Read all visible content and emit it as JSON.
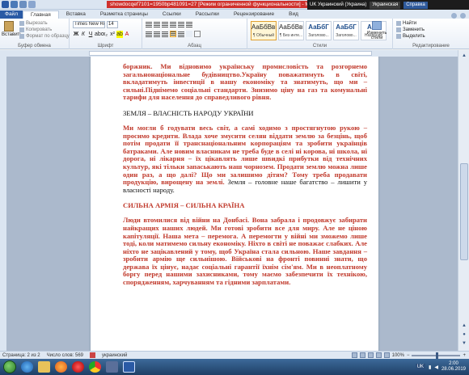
{
  "titlebar": {
    "doc_title": "showdocqef7101=1950bp481091=27 [Режим ограниченной функциональности] - Microsoft Word",
    "lang_label": "UK Украинский (Украина)",
    "kb_layout": "Украинская",
    "help_label": "Справка"
  },
  "tabs": [
    "Файл",
    "Главная",
    "Вставка",
    "Разметка страницы",
    "Ссылки",
    "Рассылки",
    "Рецензирование",
    "Вид"
  ],
  "ribbon": {
    "paste_label": "Вставить",
    "cut_label": "Вырезать",
    "copy_label": "Копировать",
    "format_painter_label": "Формат по образцу",
    "clipboard_group": "Буфер обмена",
    "font_name": "Times New Rom",
    "font_size": "14",
    "font_group": "Шрифт",
    "para_group": "Абзац",
    "styles": [
      {
        "sample": "АаБбВвГ",
        "name": "¶ Обычный",
        "heading": false
      },
      {
        "sample": "АаБбВвГ",
        "name": "¶ Без инте...",
        "heading": false
      },
      {
        "sample": "АаБбГ",
        "name": "Заголово...",
        "heading": true
      },
      {
        "sample": "АаБбГ",
        "name": "Заголово...",
        "heading": true
      },
      {
        "sample": "АаБ",
        "name": "Название",
        "heading": true
      }
    ],
    "styles_group": "Стили",
    "change_styles_label": "Изменить стили",
    "find_label": "Найти",
    "replace_label": "Заменить",
    "select_label": "Выделить",
    "edit_group": "Редактирование"
  },
  "document": {
    "p1": "боржник. Ми відновимо українську промисловість та розгорнемо загальнонаціональне будівництво.Україну поважатимуть в світі, вкладатимуть інвестиції в нашу економіку та знатимуть, що ми – сильні.Піднімемо соціальні стандарти. Знизимо ціну на газ та комунальні тарифи для населення до справедливого рівня.",
    "h1": "ЗЕМЛЯ – ВЛАСНІСТЬ НАРОДУ УКРАЇНИ",
    "p2_red": "Ми могли б годувати весь світ, а самі ходимо з простягнутою рукою – просимо кредити. Влада хоче змусити селян віддати землю за безцінь, щоб потім продати її транснаціональним корпораціям та зробити українців батраками. Але новим власникам не треба буде в селі ні корова, ні школа, ні дорога, ні лікарня – їх цікавлять лише швидкі прибутки від технічних культур, які тільки запаськають наш чорнозем. Продати землю можна лише один раз, а що далі? Що ми залишимо дітям? Тому треба продавати продукцію, вирощену на землі.",
    "p2_black": " Земля – головне наше багатство – лишити у власності народу.",
    "h2": "СИЛЬНА АРМІЯ – СИЛЬНА КРАЇНА",
    "p3": "Люди втомилися від війни на Донбасі. Вона забрала і продовжує забирати найкращих наших людей. Ми готові зробити все для миру. Але не ціною капітуляції. Наша мета – перемога. А перемогти у війні ми зможемо лише тоді, коли матимемо сильну економіку. Ніхто в світі не поважає слабких. Але ніхто не зацікавлений у тому, щоб Україна стала сильною. Наше завдання – зробити армію ще сильнішою. Військові на фронті повинні знати, що держава їх цінує, надає соціальні гарантії їхнім сім'ям. Ми в неоплатному боргу перед нашими захисниками, тому маємо забезпечити їх технікою, спорядженням, харчуванням та гідними зарплатами."
  },
  "status": {
    "page": "Страница: 2 из 2",
    "words": "Число слов: 569",
    "lang": "украинский",
    "zoom": "100%"
  },
  "taskbar": {
    "tray_lang": "UK",
    "time": "2:00",
    "date": "28.06.2019"
  },
  "colors": {
    "doc_red": "#c0392b",
    "title_red": "#d0312d",
    "word_blue": "#2a5aa5"
  }
}
